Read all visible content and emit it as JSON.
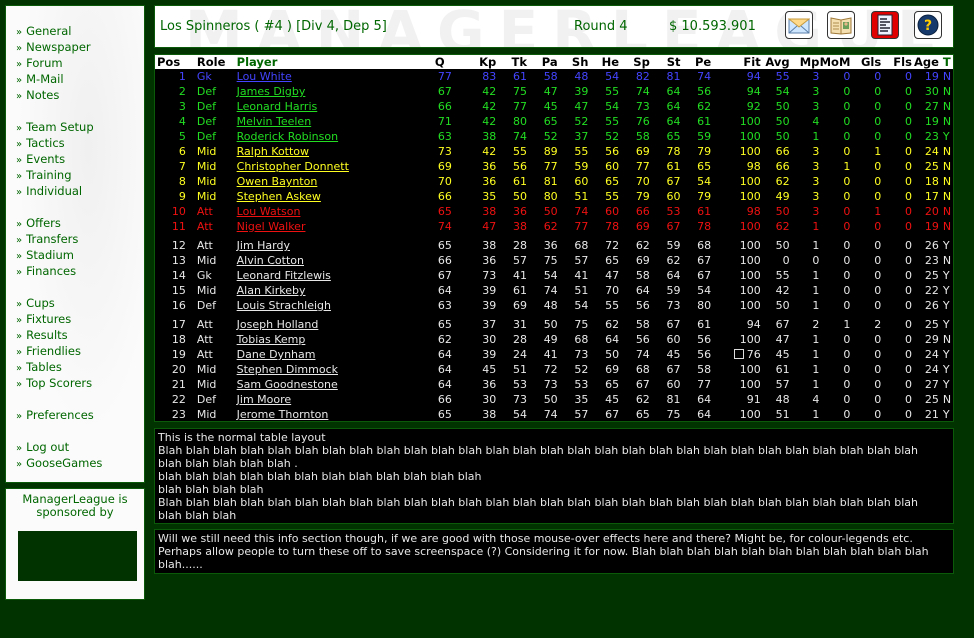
{
  "sidebar": {
    "groups": [
      [
        "General",
        "Newspaper",
        "Forum",
        "M-Mail",
        "Notes"
      ],
      [
        "Team Setup",
        "Tactics",
        "Events",
        "Training",
        "Individual"
      ],
      [
        "Offers",
        "Transfers",
        "Stadium",
        "Finances"
      ],
      [
        "Cups",
        "Fixtures",
        "Results",
        "Friendlies",
        "Tables",
        "Top Scorers"
      ],
      [
        "Preferences"
      ],
      [
        "Log out",
        "GooseGames"
      ]
    ],
    "bullet": "»"
  },
  "sponsor": {
    "text_line1": "ManagerLeague is",
    "text_line2": "sponsored by"
  },
  "header": {
    "watermark": "MANAGERLEAGUE",
    "team": "Los Spinneros ( #4 ) [Div 4, Dep 5]",
    "round": "Round 4",
    "money": "$ 10.593.901",
    "icons": [
      "mail-icon",
      "newspaper-icon",
      "report-icon",
      "help-icon"
    ]
  },
  "colors": {
    "gk": "#4444ff",
    "def": "#22dd22",
    "mid": "#ffff22",
    "att": "#ee1111",
    "reserve": "#e8e8e8",
    "brand_green": "#006600",
    "background": "#003300"
  },
  "table": {
    "headers": [
      "Pos",
      "Role",
      "Player",
      "Q",
      "Kp",
      "Tk",
      "Pa",
      "Sh",
      "He",
      "Sp",
      "St",
      "Pe",
      "Fit",
      "Avg",
      "Mp",
      "MoM",
      "Gls",
      "Fls",
      "Age",
      "T"
    ],
    "starters": [
      {
        "pos": "1",
        "role": "Gk",
        "player": "Lou White",
        "q": "77",
        "kp": "83",
        "tk": "61",
        "pa": "58",
        "sh": "48",
        "he": "54",
        "sp": "82",
        "st": "81",
        "pe": "74",
        "fit": "94",
        "avg": "55",
        "mp": "3",
        "mom": "0",
        "gls": "0",
        "fls": "0",
        "age": "19",
        "t": "N",
        "cls": "gk"
      },
      {
        "pos": "2",
        "role": "Def",
        "player": "James Digby",
        "q": "67",
        "kp": "42",
        "tk": "75",
        "pa": "47",
        "sh": "39",
        "he": "55",
        "sp": "74",
        "st": "64",
        "pe": "56",
        "fit": "94",
        "avg": "54",
        "mp": "3",
        "mom": "0",
        "gls": "0",
        "fls": "0",
        "age": "30",
        "t": "N",
        "cls": "def"
      },
      {
        "pos": "3",
        "role": "Def",
        "player": "Leonard Harris",
        "q": "66",
        "kp": "42",
        "tk": "77",
        "pa": "45",
        "sh": "47",
        "he": "54",
        "sp": "73",
        "st": "64",
        "pe": "62",
        "fit": "92",
        "avg": "50",
        "mp": "3",
        "mom": "0",
        "gls": "0",
        "fls": "0",
        "age": "27",
        "t": "N",
        "cls": "def"
      },
      {
        "pos": "4",
        "role": "Def",
        "player": "Melvin Teelen",
        "q": "71",
        "kp": "42",
        "tk": "80",
        "pa": "65",
        "sh": "52",
        "he": "55",
        "sp": "76",
        "st": "64",
        "pe": "61",
        "fit": "100",
        "avg": "50",
        "mp": "4",
        "mom": "0",
        "gls": "0",
        "fls": "0",
        "age": "19",
        "t": "N",
        "cls": "def"
      },
      {
        "pos": "5",
        "role": "Def",
        "player": "Roderick Robinson",
        "q": "63",
        "kp": "38",
        "tk": "74",
        "pa": "52",
        "sh": "37",
        "he": "52",
        "sp": "58",
        "st": "65",
        "pe": "59",
        "fit": "100",
        "avg": "50",
        "mp": "1",
        "mom": "0",
        "gls": "0",
        "fls": "0",
        "age": "23",
        "t": "Y",
        "cls": "def"
      },
      {
        "pos": "6",
        "role": "Mid",
        "player": "Ralph Kottow",
        "q": "73",
        "kp": "42",
        "tk": "55",
        "pa": "89",
        "sh": "55",
        "he": "56",
        "sp": "69",
        "st": "78",
        "pe": "79",
        "fit": "100",
        "avg": "66",
        "mp": "3",
        "mom": "0",
        "gls": "1",
        "fls": "0",
        "age": "24",
        "t": "N",
        "cls": "mid"
      },
      {
        "pos": "7",
        "role": "Mid",
        "player": "Christopher Donnett",
        "q": "69",
        "kp": "36",
        "tk": "56",
        "pa": "77",
        "sh": "59",
        "he": "60",
        "sp": "77",
        "st": "61",
        "pe": "65",
        "fit": "98",
        "avg": "66",
        "mp": "3",
        "mom": "1",
        "gls": "0",
        "fls": "0",
        "age": "25",
        "t": "N",
        "cls": "mid"
      },
      {
        "pos": "8",
        "role": "Mid",
        "player": "Owen Baynton",
        "q": "70",
        "kp": "36",
        "tk": "61",
        "pa": "81",
        "sh": "60",
        "he": "65",
        "sp": "70",
        "st": "67",
        "pe": "54",
        "fit": "100",
        "avg": "62",
        "mp": "3",
        "mom": "0",
        "gls": "0",
        "fls": "0",
        "age": "18",
        "t": "N",
        "cls": "mid"
      },
      {
        "pos": "9",
        "role": "Mid",
        "player": "Stephen Askew",
        "q": "66",
        "kp": "35",
        "tk": "50",
        "pa": "80",
        "sh": "51",
        "he": "55",
        "sp": "79",
        "st": "60",
        "pe": "79",
        "fit": "100",
        "avg": "49",
        "mp": "3",
        "mom": "0",
        "gls": "0",
        "fls": "0",
        "age": "17",
        "t": "N",
        "cls": "mid"
      },
      {
        "pos": "10",
        "role": "Att",
        "player": "Lou Watson",
        "q": "65",
        "kp": "38",
        "tk": "36",
        "pa": "50",
        "sh": "74",
        "he": "60",
        "sp": "66",
        "st": "53",
        "pe": "61",
        "fit": "98",
        "avg": "50",
        "mp": "3",
        "mom": "0",
        "gls": "1",
        "fls": "0",
        "age": "20",
        "t": "N",
        "cls": "att"
      },
      {
        "pos": "11",
        "role": "Att",
        "player": "Nigel Walker",
        "q": "74",
        "kp": "47",
        "tk": "38",
        "pa": "62",
        "sh": "77",
        "he": "78",
        "sp": "69",
        "st": "67",
        "pe": "78",
        "fit": "100",
        "avg": "62",
        "mp": "1",
        "mom": "0",
        "gls": "0",
        "fls": "0",
        "age": "19",
        "t": "N",
        "cls": "att"
      }
    ],
    "subs": [
      {
        "pos": "12",
        "role": "Att",
        "player": "Jim Hardy",
        "q": "65",
        "kp": "38",
        "tk": "28",
        "pa": "36",
        "sh": "68",
        "he": "72",
        "sp": "62",
        "st": "59",
        "pe": "68",
        "fit": "100",
        "avg": "50",
        "mp": "1",
        "mom": "0",
        "gls": "0",
        "fls": "0",
        "age": "26",
        "t": "Y"
      },
      {
        "pos": "13",
        "role": "Mid",
        "player": "Alvin Cotton",
        "q": "66",
        "kp": "36",
        "tk": "57",
        "pa": "75",
        "sh": "57",
        "he": "65",
        "sp": "69",
        "st": "62",
        "pe": "67",
        "fit": "100",
        "avg": "0",
        "mp": "0",
        "mom": "0",
        "gls": "0",
        "fls": "0",
        "age": "23",
        "t": "N"
      },
      {
        "pos": "14",
        "role": "Gk",
        "player": "Leonard Fitzlewis",
        "q": "67",
        "kp": "73",
        "tk": "41",
        "pa": "54",
        "sh": "41",
        "he": "47",
        "sp": "58",
        "st": "64",
        "pe": "67",
        "fit": "100",
        "avg": "55",
        "mp": "1",
        "mom": "0",
        "gls": "0",
        "fls": "0",
        "age": "25",
        "t": "Y"
      },
      {
        "pos": "15",
        "role": "Mid",
        "player": "Alan Kirkeby",
        "q": "64",
        "kp": "39",
        "tk": "61",
        "pa": "74",
        "sh": "51",
        "he": "70",
        "sp": "64",
        "st": "59",
        "pe": "54",
        "fit": "100",
        "avg": "42",
        "mp": "1",
        "mom": "0",
        "gls": "0",
        "fls": "0",
        "age": "22",
        "t": "Y"
      },
      {
        "pos": "16",
        "role": "Def",
        "player": "Louis Strachleigh",
        "q": "63",
        "kp": "39",
        "tk": "69",
        "pa": "48",
        "sh": "54",
        "he": "55",
        "sp": "56",
        "st": "73",
        "pe": "80",
        "fit": "100",
        "avg": "50",
        "mp": "1",
        "mom": "0",
        "gls": "0",
        "fls": "0",
        "age": "26",
        "t": "Y"
      }
    ],
    "reserves": [
      {
        "pos": "17",
        "role": "Att",
        "player": "Joseph Holland",
        "q": "65",
        "kp": "37",
        "tk": "31",
        "pa": "50",
        "sh": "75",
        "he": "62",
        "sp": "58",
        "st": "67",
        "pe": "61",
        "fit": "94",
        "avg": "67",
        "mp": "2",
        "mom": "1",
        "gls": "2",
        "fls": "0",
        "age": "25",
        "t": "Y"
      },
      {
        "pos": "18",
        "role": "Att",
        "player": "Tobias Kemp",
        "q": "62",
        "kp": "30",
        "tk": "28",
        "pa": "49",
        "sh": "68",
        "he": "64",
        "sp": "56",
        "st": "60",
        "pe": "56",
        "fit": "100",
        "avg": "47",
        "mp": "1",
        "mom": "0",
        "gls": "0",
        "fls": "0",
        "age": "29",
        "t": "N"
      },
      {
        "pos": "19",
        "role": "Att",
        "player": "Dane Dynham",
        "q": "64",
        "kp": "39",
        "tk": "24",
        "pa": "41",
        "sh": "73",
        "he": "50",
        "sp": "74",
        "st": "45",
        "pe": "56",
        "fit": "76",
        "fit_flag": true,
        "avg": "45",
        "mp": "1",
        "mom": "0",
        "gls": "0",
        "fls": "0",
        "age": "24",
        "t": "Y"
      },
      {
        "pos": "20",
        "role": "Mid",
        "player": "Stephen Dimmock",
        "q": "64",
        "kp": "45",
        "tk": "51",
        "pa": "72",
        "sh": "52",
        "he": "69",
        "sp": "68",
        "st": "67",
        "pe": "58",
        "fit": "100",
        "avg": "61",
        "mp": "1",
        "mom": "0",
        "gls": "0",
        "fls": "0",
        "age": "24",
        "t": "Y"
      },
      {
        "pos": "21",
        "role": "Mid",
        "player": "Sam Goodnestone",
        "q": "64",
        "kp": "36",
        "tk": "53",
        "pa": "73",
        "sh": "53",
        "he": "65",
        "sp": "67",
        "st": "60",
        "pe": "77",
        "fit": "100",
        "avg": "57",
        "mp": "1",
        "mom": "0",
        "gls": "0",
        "fls": "0",
        "age": "27",
        "t": "Y"
      },
      {
        "pos": "22",
        "role": "Def",
        "player": "Jim Moore",
        "q": "66",
        "kp": "30",
        "tk": "73",
        "pa": "50",
        "sh": "35",
        "he": "45",
        "sp": "62",
        "st": "81",
        "pe": "64",
        "fit": "91",
        "avg": "48",
        "mp": "4",
        "mom": "0",
        "gls": "0",
        "fls": "0",
        "age": "25",
        "t": "N"
      },
      {
        "pos": "23",
        "role": "Mid",
        "player": "Jerome Thornton",
        "q": "65",
        "kp": "38",
        "tk": "54",
        "pa": "74",
        "sh": "57",
        "he": "67",
        "sp": "65",
        "st": "75",
        "pe": "64",
        "fit": "100",
        "avg": "51",
        "mp": "1",
        "mom": "0",
        "gls": "0",
        "fls": "0",
        "age": "21",
        "t": "Y"
      }
    ]
  },
  "info1": {
    "lines": [
      "This is the normal table layout",
      "Blah blah blah blah blah blah blah blah blah blah blah blah blah blah blah blah blah blah blah blah blah blah blah blah blah blah blah blah",
      "blah blah blah blah blah .",
      "blah blah blah blah blah blah blah blah blah blah blah blah",
      "blah blah blah blah",
      "Blah blah blah blah blah blah blah blah blah blah blah blah blah blah blah blah blah blah blah blah blah blah blah blah blah blah blah blah",
      "blah blah blah"
    ]
  },
  "info2": {
    "text": "Will we still need this info section though, if we are good with those mouse-over effects here and there? Might be, for colour-legends etc. Perhaps allow people to turn these off to save screenspace (?) Considering it for now. Blah blah blah blah blah blah blah blah blah blah blah blah......"
  }
}
